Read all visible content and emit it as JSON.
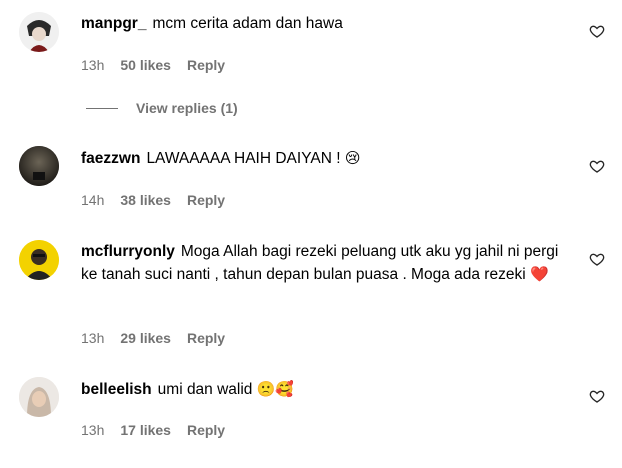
{
  "comments": [
    {
      "username": "manpgr_",
      "text": "mcm cerita adam dan hawa",
      "emoji": "",
      "time": "13h",
      "likes": "50 likes",
      "reply": "Reply",
      "view_replies": "View replies (1)",
      "avatar_icon": "profile-avatar-icon"
    },
    {
      "username": "faezzwn",
      "text": "LAWAAAAA HAIH DAIYAN !",
      "emoji": "😢",
      "time": "14h",
      "likes": "38 likes",
      "reply": "Reply",
      "avatar_icon": "profile-avatar-icon"
    },
    {
      "username": "mcflurryonly",
      "text": "Moga Allah bagi rezeki peluang utk aku yg jahil ni pergi ke tanah suci nanti , tahun depan bulan puasa . Moga ada rezeki",
      "emoji": "❤️",
      "time": "13h",
      "likes": "29 likes",
      "reply": "Reply",
      "avatar_icon": "profile-avatar-icon"
    },
    {
      "username": "belleelish",
      "text": "umi dan walid",
      "emoji": "🙁🥰",
      "time": "13h",
      "likes": "17 likes",
      "reply": "Reply",
      "avatar_icon": "profile-avatar-icon"
    }
  ],
  "icons": {
    "like": "heart-outline-icon"
  },
  "colors": {
    "meta": "#737373",
    "text": "#000000",
    "heart_emoji": "#e0245e"
  }
}
